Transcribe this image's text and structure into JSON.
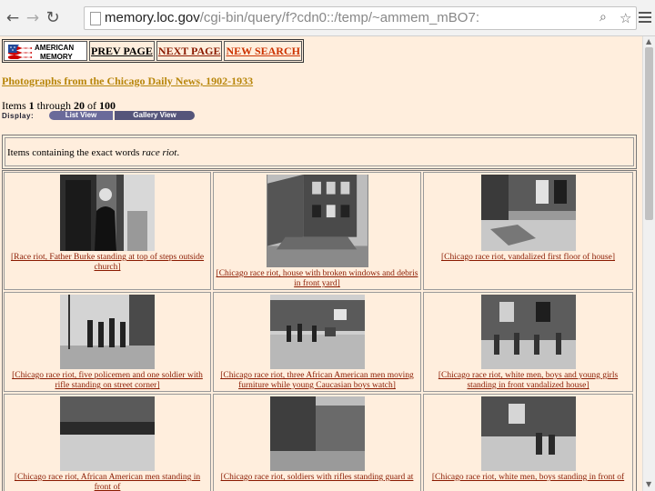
{
  "browser": {
    "url_host": "memory.loc.gov",
    "url_path": "/cgi-bin/query/f?cdn0::/temp/~ammem_mBO7:",
    "back_icon": "arrow-left-icon",
    "forward_icon": "arrow-right-icon",
    "reload_icon": "reload-icon",
    "zoom_icon": "magnifier-icon",
    "bookmark_icon": "star-icon",
    "menu_icon": "hamburger-menu-icon"
  },
  "nav": {
    "logo_line1": "AMERICAN",
    "logo_line2": "MEMORY",
    "prev": "PREV PAGE",
    "next": "NEXT PAGE",
    "new_search": "NEW SEARCH"
  },
  "collection_title": "Photographs from the Chicago Daily News, 1902-1933",
  "items": {
    "prefix": "Items ",
    "start": "1",
    "through": " through ",
    "end": "20",
    "of": " of ",
    "total": "100"
  },
  "display": {
    "label": "Display:",
    "list_view": "List View",
    "gallery_view": "Gallery View"
  },
  "search_note": {
    "prefix": "Items containing the exact words ",
    "terms": "race riot",
    "suffix": "."
  },
  "gallery": [
    {
      "caption": "[Race riot, Father Burke standing at top of steps outside church]"
    },
    {
      "caption": "[Chicago race riot, house with broken windows and debris in front yard]"
    },
    {
      "caption": "[Chicago race riot, vandalized first floor of house]"
    },
    {
      "caption": "[Chicago race riot, five policemen and one soldier with rifle standing on street corner]"
    },
    {
      "caption": "[Chicago race riot, three African American men moving furniture while young Caucasian boys watch]"
    },
    {
      "caption": "[Chicago race riot, white men, boys and young girls standing in front vandalized house]"
    },
    {
      "caption": "[Chicago race riot, African American men standing in front of"
    },
    {
      "caption": "[Chicago race riot, soldiers with rifles standing guard at"
    },
    {
      "caption": "[Chicago race riot, white men, boys standing in front of"
    }
  ],
  "colors": {
    "page_bg": "#ffeedd",
    "link_visited": "#8a1a00",
    "title_gold": "#b8860b"
  }
}
